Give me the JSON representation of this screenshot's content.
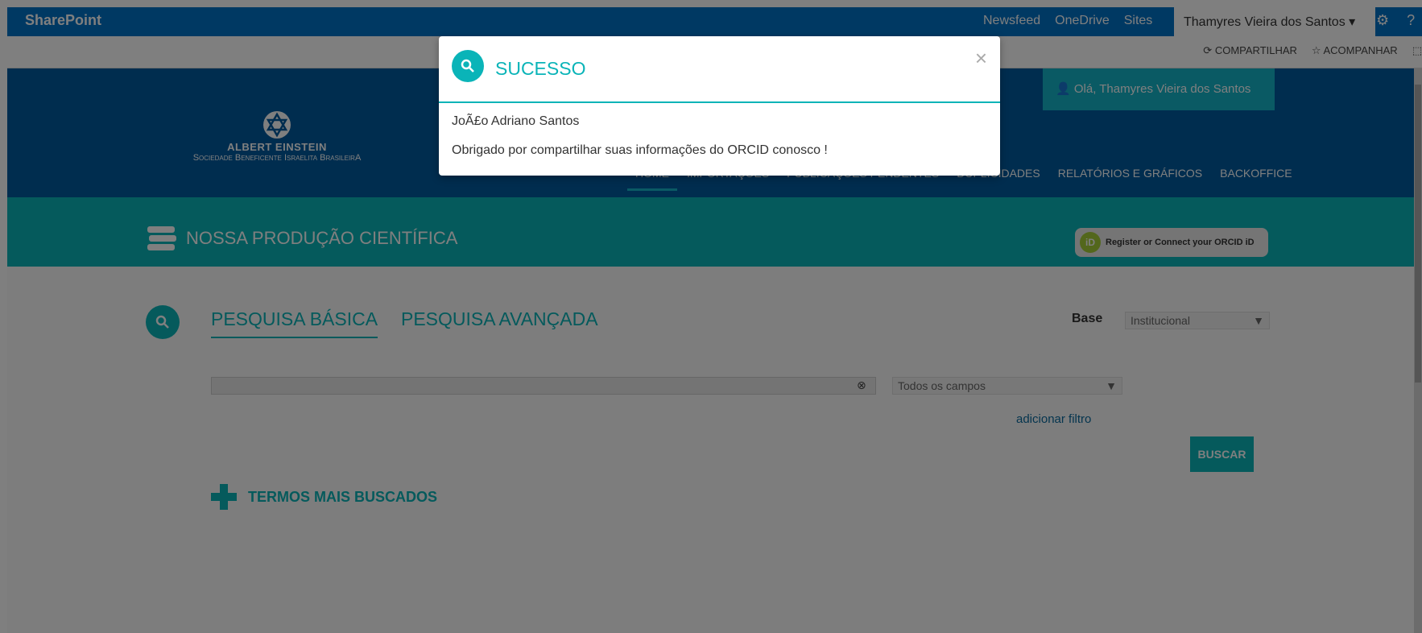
{
  "suite_bar": {
    "brand": "SharePoint",
    "links": [
      "Newsfeed",
      "OneDrive",
      "Sites"
    ],
    "user_name": "Thamyres Vieira dos Santos",
    "user_caret": "▾",
    "settings_icon": "gear-icon",
    "help_icon": "?"
  },
  "command_bar": {
    "share": "COMPARTILHAR",
    "follow": "ACOMPANHAR"
  },
  "header": {
    "logo_line1": "ALBERT EINSTEIN",
    "logo_line2": "Sociedade Beneficente Israelita BrasileirA",
    "greeting": "Olá, Thamyres Vieira dos Santos",
    "nav": [
      "HOME",
      "IMPORTAÇÕES",
      "PUBLICAÇÕES PENDENTES",
      "DUPLICIDADES",
      "RELATÓRIOS E GRÁFICOS",
      "BACKOFFICE"
    ],
    "active_nav": "HOME"
  },
  "banner": {
    "title": "NOSSA PRODUÇÃO CIENTÍFICA",
    "orcid_label": "Register or Connect your ORCID iD",
    "orcid_badge": "iD"
  },
  "search": {
    "tabs": [
      "PESQUISA BÁSICA",
      "PESQUISA AVANÇADA"
    ],
    "base_label": "Base",
    "base_value": "Institucional",
    "field_select": "Todos os campos",
    "input_value": "",
    "clear_symbol": "⊗",
    "add_filter": "adicionar filtro",
    "search_button": "BUSCAR",
    "top_terms": "TERMOS MAIS BUSCADOS"
  },
  "modal": {
    "title": "SUCESSO",
    "close": "×",
    "name_line": "JoÃ£o Adriano Santos",
    "message": "Obrigado por compartilhar suas informações do ORCID conosco !"
  },
  "colors": {
    "suite_blue": "#0072c6",
    "header_blue": "#005a9e",
    "teal": "#0ab4b8",
    "orcid_green": "#a6ce39"
  }
}
